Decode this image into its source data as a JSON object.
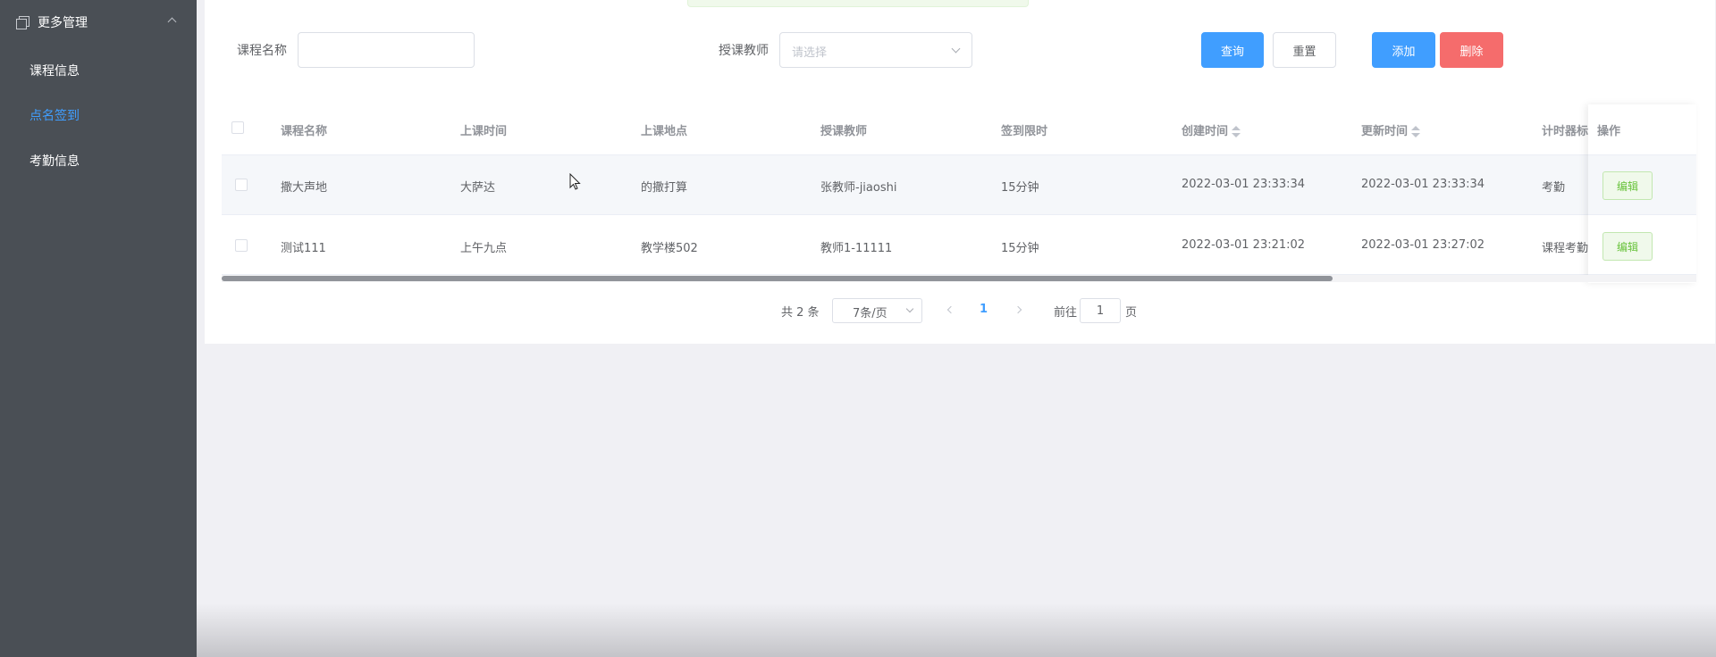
{
  "sidebar": {
    "menu_title": "更多管理",
    "items": [
      {
        "label": "课程信息"
      },
      {
        "label": "点名签到"
      },
      {
        "label": "考勤信息"
      }
    ]
  },
  "search": {
    "course_label": "课程名称",
    "course_value": "",
    "teacher_label": "授课教师",
    "teacher_placeholder": "请选择"
  },
  "toolbar": {
    "query": "查询",
    "reset": "重置",
    "add": "添加",
    "delete": "删除"
  },
  "table": {
    "headers": [
      "课程名称",
      "上课时间",
      "上课地点",
      "授课教师",
      "签到限时",
      "创建时间",
      "更新时间",
      "计时器标",
      "操作"
    ],
    "rows": [
      {
        "name": "撒大声地",
        "time": "大萨达",
        "place": "的撒打算",
        "teacher": "张教师-jiaoshi",
        "limit": "15分钟",
        "created": "2022-03-01 23:33:34",
        "updated": "2022-03-01 23:33:34",
        "timer": "考勤",
        "action": "编辑"
      },
      {
        "name": "测试111",
        "time": "上午九点",
        "place": "教学楼502",
        "teacher": "教师1-11111",
        "limit": "15分钟",
        "created": "2022-03-01 23:21:02",
        "updated": "2022-03-01 23:27:02",
        "timer": "课程考勤",
        "action": "编辑"
      }
    ]
  },
  "pagination": {
    "total": "共 2 条",
    "page_size": "7条/页",
    "current_page": "1",
    "goto_label": "前往",
    "goto_value": "1",
    "page_suffix": "页"
  },
  "colors": {
    "primary": "#409eff",
    "danger": "#f56c6c",
    "success": "#67c23a",
    "sidebar": "#4a4f55"
  }
}
